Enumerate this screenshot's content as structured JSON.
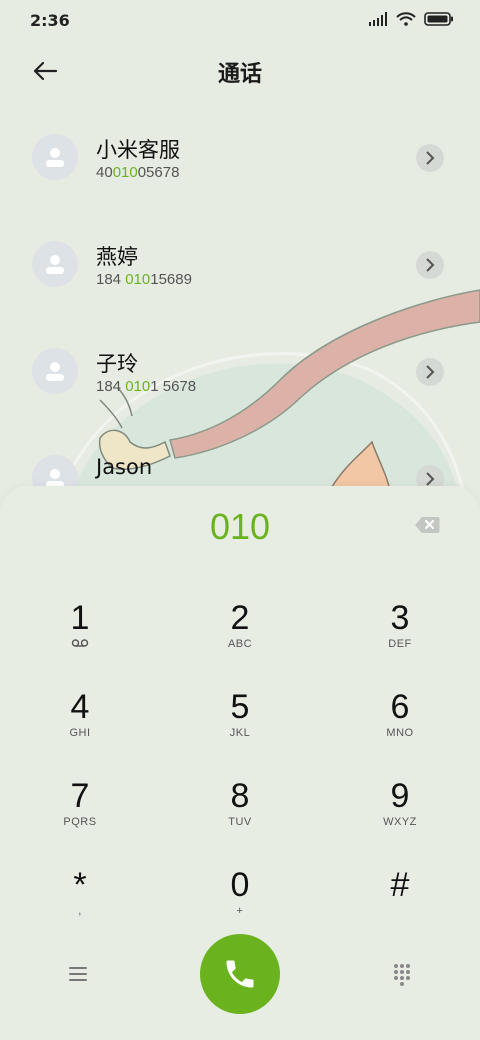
{
  "status": {
    "time": "2:36"
  },
  "header": {
    "title": "通话"
  },
  "contacts": [
    {
      "name": "小米客服",
      "num_pre": "40",
      "num_hl": "010",
      "num_post": "05678"
    },
    {
      "name": "燕婷",
      "num_pre": "184 ",
      "num_hl": "010",
      "num_post": "15689"
    },
    {
      "name": "子玲",
      "num_pre": "184 ",
      "num_hl": "010",
      "num_post": "1 5678"
    },
    {
      "name": "Jason",
      "num_pre": "",
      "num_hl": "",
      "num_post": ""
    }
  ],
  "dial": {
    "input": "010"
  },
  "keys": [
    {
      "digit": "1",
      "letters": ""
    },
    {
      "digit": "2",
      "letters": "ABC"
    },
    {
      "digit": "3",
      "letters": "DEF"
    },
    {
      "digit": "4",
      "letters": "GHI"
    },
    {
      "digit": "5",
      "letters": "JKL"
    },
    {
      "digit": "6",
      "letters": "MNO"
    },
    {
      "digit": "7",
      "letters": "PQRS"
    },
    {
      "digit": "8",
      "letters": "TUV"
    },
    {
      "digit": "9",
      "letters": "WXYZ"
    },
    {
      "digit": "*",
      "letters": ","
    },
    {
      "digit": "0",
      "letters": "+"
    },
    {
      "digit": "#",
      "letters": ""
    }
  ],
  "icons": {
    "back": "arrow-left-icon",
    "backspace": "backspace-icon",
    "call": "phone-icon",
    "menu": "menu-icon",
    "keypad": "keypad-icon",
    "voicemail": "voicemail-icon"
  },
  "colors": {
    "accent": "#6ab31e",
    "background": "#e7ece2"
  }
}
